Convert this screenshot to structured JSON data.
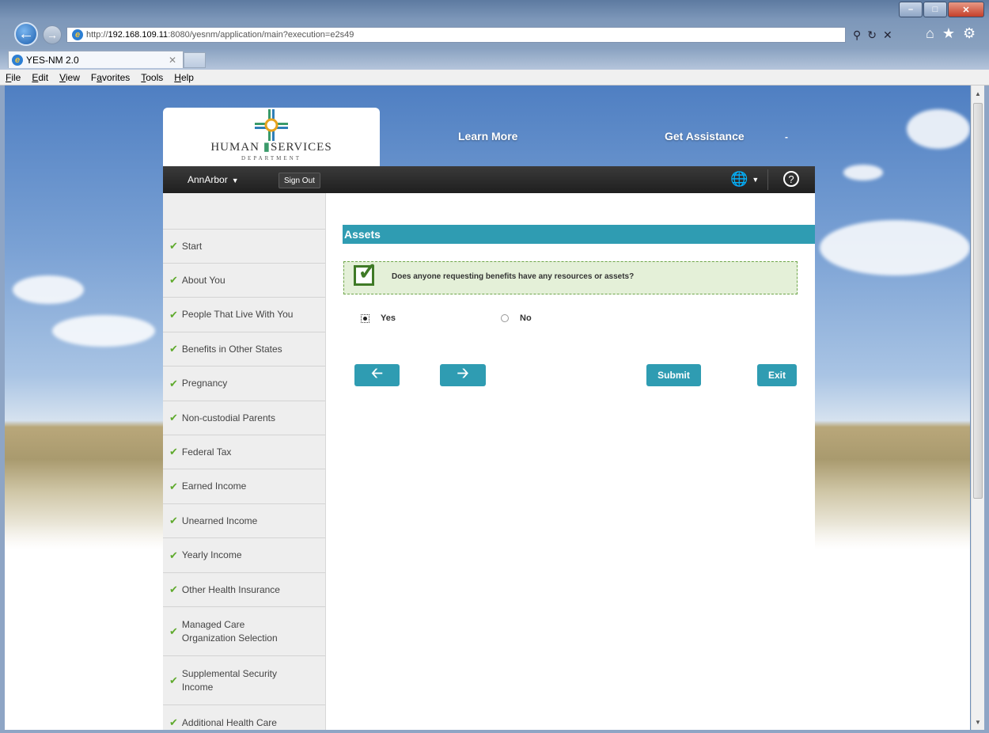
{
  "browser": {
    "url_prefix": "http://",
    "url_host": "192.168.109.11",
    "url_rest": ":8080/yesnm/application/main?execution=e2s49",
    "tab_title": "YES-NM 2.0",
    "menu": [
      {
        "label_u": "F",
        "label_rest": "ile"
      },
      {
        "label_u": "E",
        "label_rest": "dit"
      },
      {
        "label_u": "V",
        "label_rest": "iew"
      },
      {
        "label_pre": "F",
        "label_u": "a",
        "label_rest": "vorites"
      },
      {
        "label_u": "T",
        "label_rest": "ools"
      },
      {
        "label_u": "H",
        "label_rest": "elp"
      }
    ]
  },
  "header": {
    "logo_main_left": "HUMAN",
    "logo_main_right": "SERVICES",
    "logo_sub": "DEPARTMENT",
    "learn_more": "Learn More",
    "get_assistance": "Get Assistance",
    "dash": "-"
  },
  "navbar": {
    "user": "AnnArbor",
    "sign_out": "Sign Out"
  },
  "sidebar": {
    "items": [
      {
        "label": "Start"
      },
      {
        "label": "About You"
      },
      {
        "label": "People That Live With You"
      },
      {
        "label": "Benefits in Other States"
      },
      {
        "label": "Pregnancy"
      },
      {
        "label": "Non-custodial Parents"
      },
      {
        "label": "Federal Tax"
      },
      {
        "label": "Earned Income"
      },
      {
        "label": "Unearned Income"
      },
      {
        "label": "Yearly Income"
      },
      {
        "label": "Other Health Insurance"
      },
      {
        "label": "Managed Care Organization Selection"
      },
      {
        "label": "Supplemental Security Income"
      },
      {
        "label": "Additional Health Care"
      }
    ]
  },
  "main": {
    "section_title": "Assets",
    "question": "Does anyone requesting benefits have any resources or assets?",
    "options": [
      {
        "label": "Yes",
        "selected": true
      },
      {
        "label": "No",
        "selected": false
      }
    ],
    "submit_label": "Submit",
    "exit_label": "Exit"
  },
  "colors": {
    "accent": "#2f9cb2",
    "check_green": "#5faa2d",
    "navbar": "#2a2a2a"
  }
}
